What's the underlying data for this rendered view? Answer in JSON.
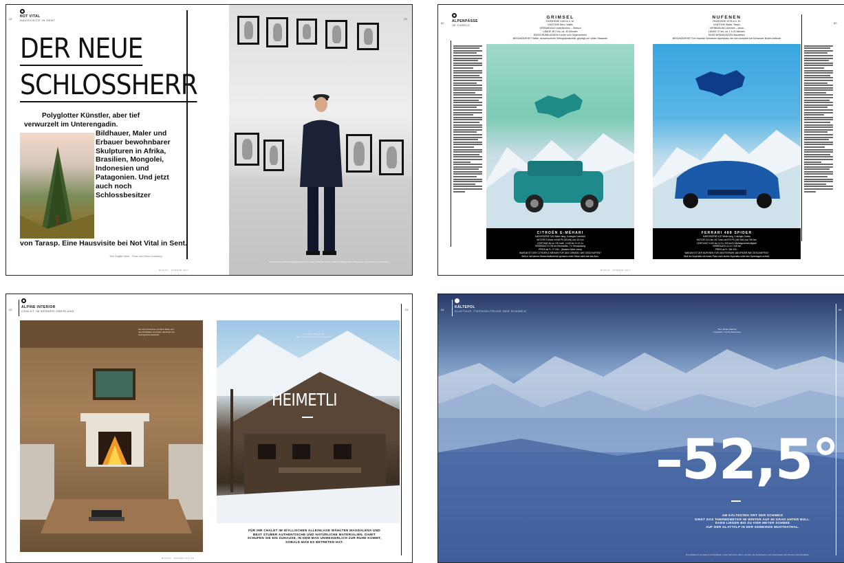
{
  "spread1": {
    "page_left": "22",
    "page_right": "23",
    "section": "NOT VITAL",
    "subsection": "HAUSVISITE IN SENT",
    "headline_line1": "DER NEUE",
    "headline_line2": "SCHLOSSHERR",
    "lead_line1": "Polyglotter Künstler, aber tief",
    "lead_line2": "verwurzelt im Unterengadin.",
    "wrap_text": "Bildhauer, Maler und Erbauer bewohnbarer Skulpturen in Afrika, Brasilien, Mongolei, Indonesien und Patagonien. Und jetzt auch noch Schlossbesitzer",
    "tail_text": "von Tarasp. Eine Hausvisite bei Not Vital in Sent.",
    "credits": "Text: Brigitte Ulmer · Fotos: Alex Morin-Goodberg",
    "photo_caption": "Der Künstler macht Kunstpräsentationen im Atelier: Portraits mit der Hand von Bretterwald. 3 Bilder hier und mehrere im Glas leben.",
    "footer": "BIANCO · SOMMER 2017"
  },
  "spread2": {
    "page_left": "82",
    "page_right": "83",
    "section": "ALPENPÄSSE",
    "subsection": "IM CABRIO",
    "left_pass": {
      "name": "GRIMSEL",
      "lines": [
        "PASSHÖHE 2164 m ü. M.",
        "KANTONE Bern, Wallis",
        "VERBINDUNG Innertkirchen – Gletsch",
        "LÄNGE 38,2 km, ca. 40 Minuten",
        "EINSCHRÄNKUNGEN Kurven und Gegenverkehr",
        "BESONDERHEIT Wilde, wunderschöne Gebirgslandschaft, geprägt von vielen Stauseen"
      ]
    },
    "right_pass": {
      "name": "NUFENEN",
      "lines": [
        "PASSHÖHE 2478 m ü. M.",
        "KANTONE Wallis, Tessin",
        "VERBINDUNG Ulrichen – Airolo",
        "LÄNGE 37 km, ca. 1 h 20 Minuten",
        "EINSCHRÄNKUNGEN Baustellen",
        "BESONDERHEIT Der höchste Schweizer Alpenpass, der sich komplett auf Schweizer Boden befindet"
      ]
    },
    "left_car": {
      "name": "CITROËN E-MÉHARI",
      "lines": [
        "KAROSSERIE 3,81 Meter lang, 4-sitziges Cabriolet",
        "MOTOR E-Motor mit 68 PS (50 kW) und 110 km",
        "LEISTUNG bis zu 100 km/h, 0-100 km in 13,4 s",
        "VERBRAUCH 195 km Reichweite, 7 h Stromladung",
        "PREIS ab Fr. 27 000.– (Batterie-Miete extra)",
        "WARUM IST DER CITROËN E-MÉHARI FÜR DEN GRIMSEL WIE GESCHAFFEN?",
        "Weil er mit seinem Wasserkraftwerken genauso unter Strom steht wie das Auto."
      ]
    },
    "right_car": {
      "name": "FERRARI 488 SPIDER",
      "lines": [
        "KAROSSERIE 4,57 Meter lang, 2-sitziges Cabrio",
        "MOTOR 3,9-Liter V8-Turbo mit 670 PS (492 kW) und 760 Nm",
        "LEISTUNG 0-100 km in 3 s, 325 km/h Höchstgeschwindigkeit",
        "VERBRAUCH 11,4 l / 100 km",
        "PREIS ab Fr. 284 000.–",
        "WARUM IST DER NUFENEN FÜR DEN FERRARI 488 SPIDER WIE GESCHAFFEN?",
        "Weil ein Superlativ mit einem Pass auch einem Superlativ unter den Sportwagen schreit."
      ]
    },
    "footer": "BIANCO · SOMMER 2017"
  },
  "spread3": {
    "page_left": "22",
    "page_right": "23",
    "section": "ALPINE INTERIOR",
    "subsection": "CHALET IM BERNER OBERLAND",
    "title": "HEIMETLI",
    "photo_credit_line1": "Fotografie: Reto Guntli",
    "photo_credit_line2": "Text: Christine Kopp, Helene Wiegand",
    "overlay_text": "Sie schuf zusammen mit ihrem Mann und dem Architekten ein Chalet, das Ruhe und Geborgenheit ausstrahlt.",
    "caption": "FÜR IHR CHALET IM IDYLLISCHEN ALLEINLAGE WÄHLTEN MAGDALENA UND BEAT STUBER AUTHENTISCHE UND NATÜRLICHE MATERIALIEN. DAMIT SCHUFEN SIE EIN ZUHAUSE, IN DEM MAN UNWEIGERLICH ZUR RUHE KOMMT, SOBALD MAN ES BETRETEN HAT.",
    "footer": "BIANCO · WINTER 2017/18"
  },
  "spread4": {
    "page_left": "64",
    "page_right": "65",
    "section": "KÄLTEPOL",
    "subsection": "GLATTALP, TIEFKÜHLTRUHE DER SCHWEIZ",
    "credit_line1": "Text: Stefan Wabnitz",
    "credit_line2": "Fotografie: Yvonne Bossmann",
    "big_temp": "–52,5°",
    "subline1": "AM KÄLTESTEN ORT DER SCHWEIZ",
    "subline2": "SINKT DAS THERMOMETER IM WINTER AUF 50 GRAD UNTER NULL.",
    "subline3": "DANN LIEGEN BIS ZU VIER METER SCHNEE",
    "subline4": "AUF DER GLATTALP IN DER GEMEINDE MUOTHATHAL.",
    "caption": "Die Glattalp ist ein kleines Hochplateau in den Schwyzer Alpen, auf dem die Alpbetriebe in der Alpensaison die Sommer bewirtschaften."
  }
}
